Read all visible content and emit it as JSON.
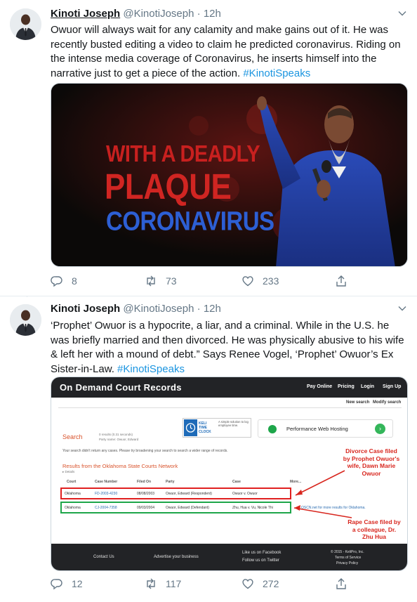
{
  "tweets": [
    {
      "author_name": "Kinoti Joseph",
      "handle": "@KinotiJoseph",
      "separator": "·",
      "time": "12h",
      "text": "Owuor will always wait for any calamity and make gains out of it. He was recently busted editing a video to claim he predicted coronavirus. Riding on the intense media coverage of Coronavirus, he inserts himself into the narrative just to get a piece of the action.",
      "hashtag": "#KinotiSpeaks",
      "media": {
        "line1": "WITH A DEADLY",
        "line2": "PLAQUE",
        "line3": "CORONAVIRUS"
      },
      "replies": "8",
      "retweets": "73",
      "likes": "233"
    },
    {
      "author_name": "Kinoti Joseph",
      "handle": "@KinotiJoseph",
      "separator": "·",
      "time": "12h",
      "text": "‘Prophet’ Owuor is a hypocrite, a liar, and a criminal. While in the U.S. he was briefly married and then divorced. He was physically abusive to his wife & left her with a mound of debt.” Says Renee Vogel, ‘Prophet’ Owuor’s Ex Sister-in-Law.",
      "hashtag": "#KinotiSpeaks",
      "media": {
        "brand": "On Demand Court Records",
        "nav": [
          "Pay Online",
          "Pricing",
          "Login",
          "Sign Up"
        ],
        "subnav": [
          "New search",
          "Modify search"
        ],
        "search_label": "Search",
        "result_meta": "0 results (0.31 seconds)",
        "party_name": "Party name: Owuor, Edward",
        "ad1_brand": "KELI TIME CLOCK",
        "ad1_text": "A simple solution to log employee time.",
        "ad2_text": "Performance Web Hosting",
        "no_results": "Your search didn't return any cases. Please try broadening your search to search a wider range of records.",
        "results_heading": "Results from the Oklahoma State Courts Network",
        "details": "▸ Details",
        "columns": [
          "Court",
          "Case Number",
          "Filed On",
          "Party",
          "Case",
          "More..."
        ],
        "rows": [
          [
            "Oklahoma",
            "FD-2003-4230",
            "08/08/2003",
            "Owuor, Edward (Respondent)",
            "Owuor v. Owuor"
          ],
          [
            "Oklahoma",
            "CJ-2004-7358",
            "09/03/2004",
            "Owuor, Edward (Defendant)",
            "Zhu, Hua v. Vu, Nicole Thi"
          ]
        ],
        "oscn_note": "OSCN.net for more results for Oklahoma.",
        "annotation_divorce": "Divorce Case filed by Prophet Owuor's wife, Dawn Marie Owuor",
        "annotation_rape": "Rape Case filed by a colleague, Dr. Zhu Hua",
        "footer": {
          "contact": "Contact Us",
          "advertise": "Advertise your business",
          "facebook": "Like us on Facebook",
          "twitter": "Follow us on Twitter",
          "copyright": "© 2015 - KeliPro, Inc.",
          "terms": "Terms of Service",
          "privacy": "Privacy Policy"
        }
      },
      "replies": "12",
      "retweets": "117",
      "likes": "272"
    }
  ],
  "colors": {
    "link": "#1b95e0",
    "text": "#14171a",
    "muted": "#657786",
    "divider": "#e6ecf0"
  }
}
